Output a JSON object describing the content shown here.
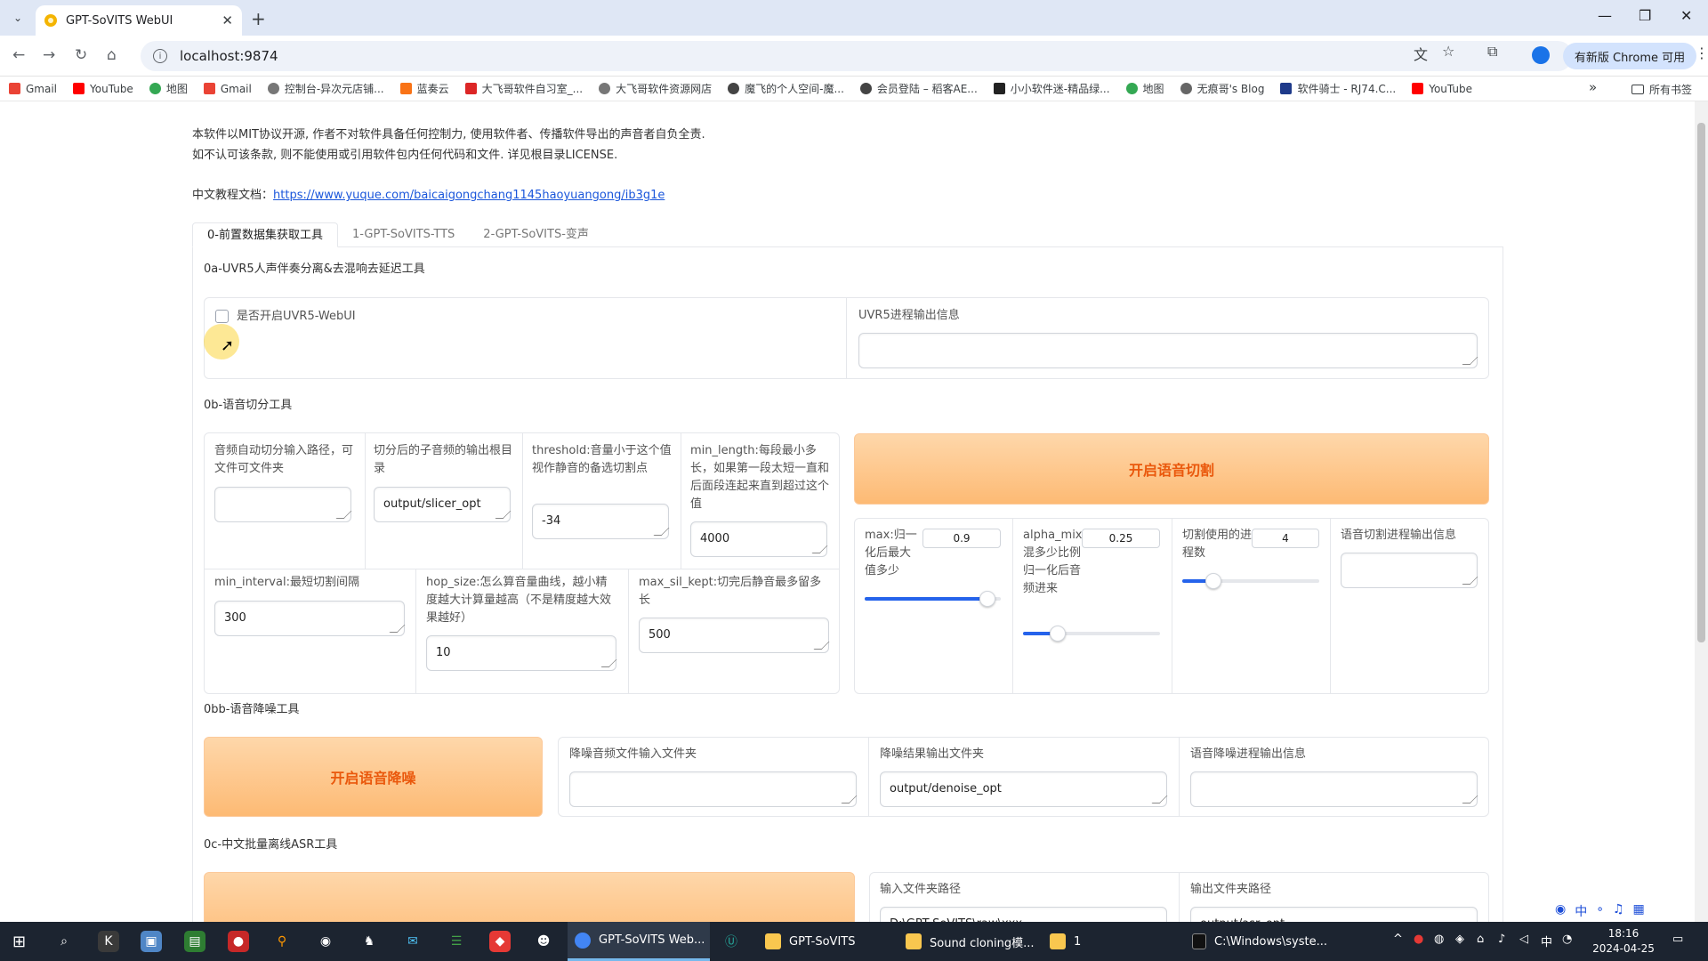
{
  "browser": {
    "tab_title": "GPT-SoVITS WebUI",
    "url": "localhost:9874",
    "update_label": "有新版 Chrome 可用",
    "bookmarks": [
      "Gmail",
      "YouTube",
      "地图",
      "Gmail",
      "控制台-异次元店铺...",
      "蓝奏云",
      "大飞哥软件自习室_...",
      "大飞哥软件资源网店",
      "魔飞的个人空间-魔...",
      "会员登陆 – 稻客AE...",
      "小小软件迷-精品绿...",
      "地图",
      "无痕哥's Blog",
      "软件骑士 - RJ74.C...",
      "YouTube"
    ],
    "all_bookmarks": "所有书签",
    "colors": {
      "tabstrip": "#dfe7f5",
      "accent": "#1a73e8"
    }
  },
  "page": {
    "disclaimer_line1": "本软件以MIT协议开源, 作者不对软件具备任何控制力, 使用软件者、传播软件导出的声音者自负全责.",
    "disclaimer_line2": "如不认可该条款, 则不能使用或引用软件包内任何代码和文件. 详见根目录LICENSE.",
    "doc_label": "中文教程文档：",
    "doc_url": "https://www.yuque.com/baicaigongchang1145haoyuangong/ib3g1e",
    "tabs": [
      "0-前置数据集获取工具",
      "1-GPT-SoVITS-TTS",
      "2-GPT-SoVITS-变声"
    ],
    "uvr5": {
      "title": "0a-UVR5人声伴奏分离&去混响去延迟工具",
      "checkbox_label": "是否开启UVR5-WebUI",
      "output_label": "UVR5进程输出信息"
    },
    "slicer": {
      "title": "0b-语音切分工具",
      "input_label": "音频自动切分输入路径，可文件可文件夹",
      "output_label": "切分后的子音频的输出根目录",
      "output_value": "output/slicer_opt",
      "threshold_label": "threshold:音量小于这个值视作静音的备选切割点",
      "threshold_value": "-34",
      "min_length_label": "min_length:每段最小多长，如果第一段太短一直和后面段连起来直到超过这个值",
      "min_length_value": "4000",
      "min_interval_label": "min_interval:最短切割间隔",
      "min_interval_value": "300",
      "hop_size_label": "hop_size:怎么算音量曲线，越小精度越大计算量越高（不是精度越大效果越好）",
      "hop_size_value": "10",
      "max_sil_kept_label": "max_sil_kept:切完后静音最多留多长",
      "max_sil_kept_value": "500",
      "start_button": "开启语音切割",
      "max_label": "max:归一化后最大值多少",
      "max_value": "0.9",
      "max_fraction": 0.9,
      "alpha_label": "alpha_mix:混多少比例归一化后音频进来",
      "alpha_value": "0.25",
      "alpha_fraction": 0.25,
      "procs_label": "切割使用的进程数",
      "procs_value": "4",
      "procs_fraction": 0.23,
      "progress_label": "语音切割进程输出信息"
    },
    "denoise": {
      "title": "0bb-语音降噪工具",
      "start_button": "开启语音降噪",
      "input_label": "降噪音频文件输入文件夹",
      "output_label": "降噪结果输出文件夹",
      "output_value": "output/denoise_opt",
      "progress_label": "语音降噪进程输出信息"
    },
    "asr": {
      "title": "0c-中文批量离线ASR工具",
      "input_label": "输入文件夹路径",
      "input_value": "D:\\GPT-SoVITS\\raw\\xxx",
      "output_label": "输出文件夹路径",
      "output_value": "output/asr_opt"
    },
    "colors": {
      "button_orange_text": "#ea580c",
      "slider_blue": "#2563eb",
      "link": "#1a56db"
    }
  },
  "taskbar": {
    "apps": [
      "GPT-SoVITS Web...",
      "GPT-SoVITS",
      "Sound cloning模...",
      "1",
      "C:\\Windows\\syste..."
    ],
    "time": "18:16",
    "date": "2024-04-25"
  }
}
